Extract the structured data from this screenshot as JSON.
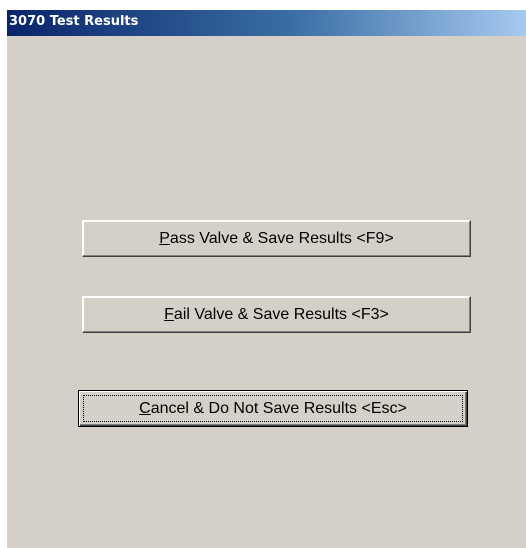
{
  "window": {
    "title": "3070 Test Results"
  },
  "buttons": {
    "pass": {
      "accel": "P",
      "rest": "ass Valve & Save Results <F9>"
    },
    "fail": {
      "accel": "F",
      "rest": "ail Valve & Save Results <F3>"
    },
    "cancel": {
      "accel": "C",
      "rest": "ancel & Do Not Save Results <Esc>"
    }
  },
  "colors": {
    "window_bg": "#d4d0c8",
    "titlebar_start": "#0a246a",
    "titlebar_end": "#a6caf0",
    "title_text": "#ffffff"
  }
}
